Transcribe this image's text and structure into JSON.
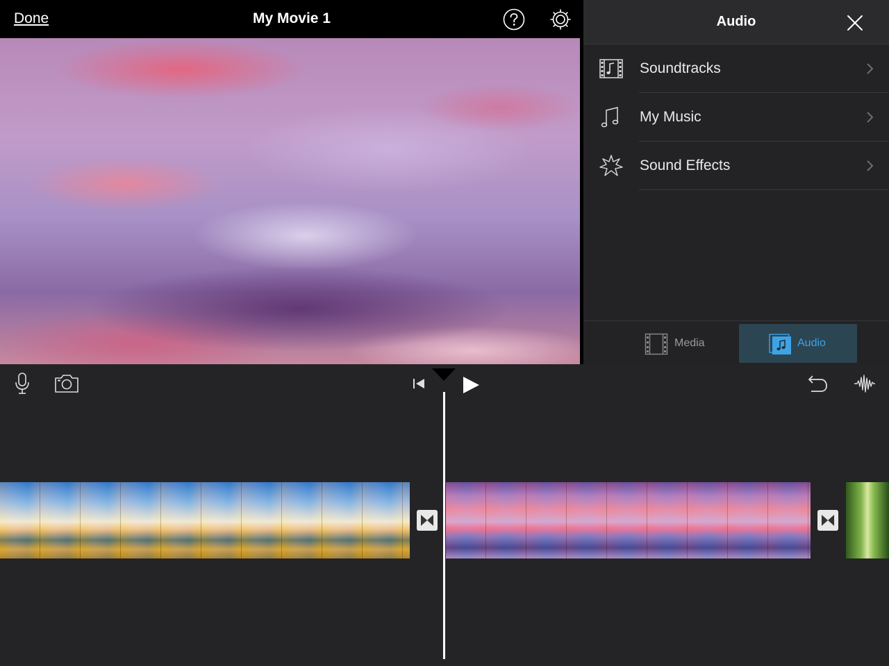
{
  "topbar": {
    "done_label": "Done",
    "title": "My Movie 1",
    "help_icon": "question-circle-icon",
    "settings_icon": "gear-icon"
  },
  "preview": {
    "content": "sky-clouds-image"
  },
  "audio_panel": {
    "title": "Audio",
    "close_icon": "close-icon",
    "items": [
      {
        "label": "Soundtracks",
        "icon": "film-music-note-icon"
      },
      {
        "label": "My Music",
        "icon": "music-notes-icon"
      },
      {
        "label": "Sound Effects",
        "icon": "starburst-icon"
      }
    ],
    "tabs": [
      {
        "label": "Media",
        "icon": "film-strip-icon",
        "selected": false
      },
      {
        "label": "Audio",
        "icon": "music-square-icon",
        "selected": true
      }
    ]
  },
  "timeline": {
    "tools": [
      "microphone-icon",
      "camera-icon",
      "skip-back-icon",
      "play-icon",
      "undo-icon",
      "waveform-icon"
    ],
    "clips": [
      "mountain-sky-clip",
      "pink-clouds-clip",
      "bamboo-forest-clip"
    ],
    "transitions": [
      "bowtie-transition-icon",
      "bowtie-transition-icon"
    ]
  },
  "colors": {
    "accent": "#3ea2e6",
    "selected_tab_bg": "#2c4552",
    "panel_bg": "#232325",
    "timeline_bg": "#242426"
  }
}
